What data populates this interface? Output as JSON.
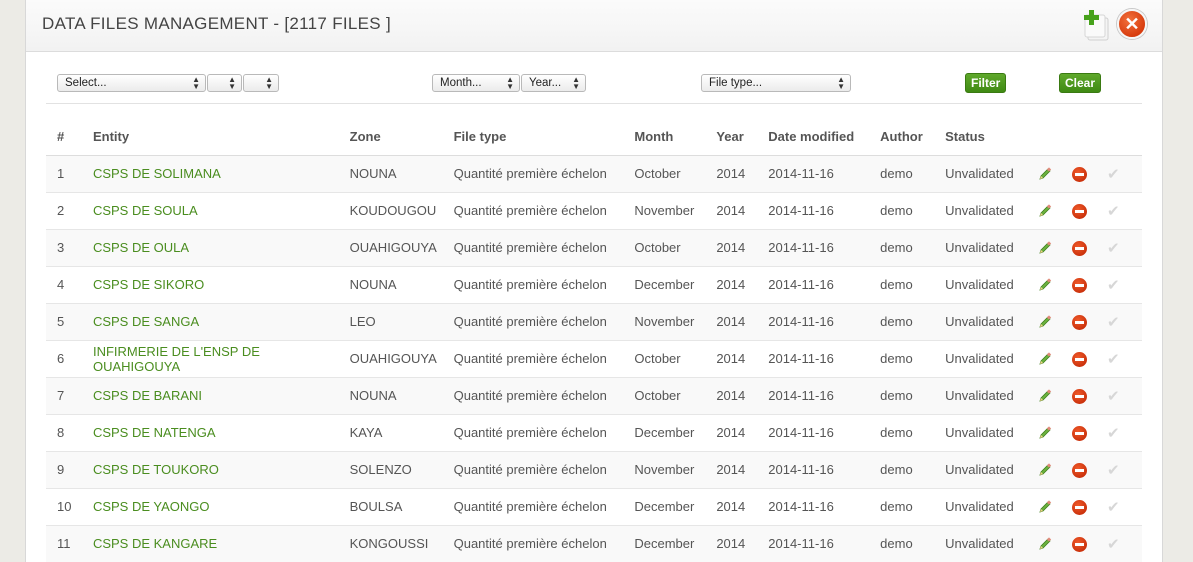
{
  "header": {
    "title": "DATA FILES MANAGEMENT - [2117 FILES ]",
    "add_icon": "add-file-icon",
    "close_icon": "close-icon",
    "close_glyph": "✕"
  },
  "filters": {
    "entity_select": "Select...",
    "sub_select_1": "",
    "sub_select_2": "",
    "month_select": "Month...",
    "year_select": "Year...",
    "filetype_select": "File type...",
    "filter_label": "Filter",
    "clear_label": "Clear"
  },
  "colors": {
    "accent_green": "#4a8d1f",
    "button_green": "#4f9a1f",
    "delete_red": "#d83d0f"
  },
  "table": {
    "columns": [
      "#",
      "Entity",
      "Zone",
      "File type",
      "Month",
      "Year",
      "Date modified",
      "Author",
      "Status"
    ],
    "rows": [
      {
        "num": "1",
        "entity": "CSPS DE SOLIMANA",
        "zone": "NOUNA",
        "file_type": "Quantité première échelon",
        "month": "October",
        "year": "2014",
        "date": "2014-11-16",
        "author": "demo",
        "status": "Unvalidated"
      },
      {
        "num": "2",
        "entity": "CSPS DE SOULA",
        "zone": "KOUDOUGOU",
        "file_type": "Quantité première échelon",
        "month": "November",
        "year": "2014",
        "date": "2014-11-16",
        "author": "demo",
        "status": "Unvalidated"
      },
      {
        "num": "3",
        "entity": "CSPS DE OULA",
        "zone": "OUAHIGOUYA",
        "file_type": "Quantité première échelon",
        "month": "October",
        "year": "2014",
        "date": "2014-11-16",
        "author": "demo",
        "status": "Unvalidated"
      },
      {
        "num": "4",
        "entity": "CSPS DE SIKORO",
        "zone": "NOUNA",
        "file_type": "Quantité première échelon",
        "month": "December",
        "year": "2014",
        "date": "2014-11-16",
        "author": "demo",
        "status": "Unvalidated"
      },
      {
        "num": "5",
        "entity": "CSPS DE SANGA",
        "zone": "LEO",
        "file_type": "Quantité première échelon",
        "month": "November",
        "year": "2014",
        "date": "2014-11-16",
        "author": "demo",
        "status": "Unvalidated"
      },
      {
        "num": "6",
        "entity": "INFIRMERIE DE L'ENSP DE OUAHIGOUYA",
        "zone": "OUAHIGOUYA",
        "file_type": "Quantité première échelon",
        "month": "October",
        "year": "2014",
        "date": "2014-11-16",
        "author": "demo",
        "status": "Unvalidated"
      },
      {
        "num": "7",
        "entity": "CSPS DE BARANI",
        "zone": "NOUNA",
        "file_type": "Quantité première échelon",
        "month": "October",
        "year": "2014",
        "date": "2014-11-16",
        "author": "demo",
        "status": "Unvalidated"
      },
      {
        "num": "8",
        "entity": "CSPS DE NATENGA",
        "zone": "KAYA",
        "file_type": "Quantité première échelon",
        "month": "December",
        "year": "2014",
        "date": "2014-11-16",
        "author": "demo",
        "status": "Unvalidated"
      },
      {
        "num": "9",
        "entity": "CSPS DE TOUKORO",
        "zone": "SOLENZO",
        "file_type": "Quantité première échelon",
        "month": "November",
        "year": "2014",
        "date": "2014-11-16",
        "author": "demo",
        "status": "Unvalidated"
      },
      {
        "num": "10",
        "entity": "CSPS DE YAONGO",
        "zone": "BOULSA",
        "file_type": "Quantité première échelon",
        "month": "December",
        "year": "2014",
        "date": "2014-11-16",
        "author": "demo",
        "status": "Unvalidated"
      },
      {
        "num": "11",
        "entity": "CSPS DE KANGARE",
        "zone": "KONGOUSSI",
        "file_type": "Quantité première échelon",
        "month": "December",
        "year": "2014",
        "date": "2014-11-16",
        "author": "demo",
        "status": "Unvalidated"
      }
    ],
    "row_actions": {
      "edit_icon": "pencil-edit-icon",
      "delete_icon": "delete-icon",
      "validate_icon": "check-icon",
      "validate_glyph": "✔"
    }
  }
}
